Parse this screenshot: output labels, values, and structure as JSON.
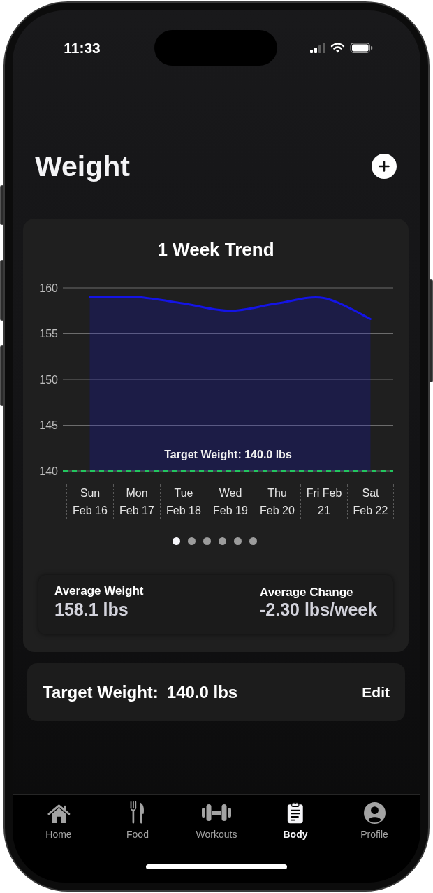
{
  "status_bar": {
    "time": "11:33"
  },
  "header": {
    "title": "Weight"
  },
  "trend_card": {
    "title": "1 Week Trend",
    "chart_data": {
      "type": "area",
      "categories": [
        "Sun\nFeb 16",
        "Mon\nFeb 17",
        "Tue\nFeb 18",
        "Wed\nFeb 19",
        "Thu\nFeb 20",
        "Fri Feb\n21",
        "Sat\nFeb 22"
      ],
      "series": [
        {
          "color": "#1414e6",
          "values": [
            159.0,
            159.0,
            158.3,
            157.5,
            158.3,
            158.9,
            156.6
          ]
        }
      ],
      "ylim": [
        140,
        160
      ],
      "yticks": [
        140,
        145,
        150,
        155,
        160
      ],
      "grid": true,
      "ref_lines": [
        {
          "axis": "y",
          "value": 140,
          "label": "Target Weight: 140.0 lbs",
          "color": "#22c55e"
        }
      ]
    },
    "pages": [
      {
        "selected": true
      },
      {
        "selected": false
      },
      {
        "selected": false
      },
      {
        "selected": false
      },
      {
        "selected": false
      },
      {
        "selected": false
      }
    ],
    "stats": [
      {
        "label": "Average Weight",
        "value": "158.1 lbs"
      },
      {
        "label": "Average Change",
        "value": "-2.30 lbs/week"
      }
    ]
  },
  "target": {
    "label": "Target Weight:",
    "value": "140.0 lbs",
    "action": "Edit"
  },
  "tab_bar": [
    {
      "label": "Home",
      "selected": false
    },
    {
      "label": "Food",
      "selected": false
    },
    {
      "label": "Workouts",
      "selected": false
    },
    {
      "label": "Body",
      "selected": true
    },
    {
      "label": "Profile",
      "selected": false
    }
  ]
}
